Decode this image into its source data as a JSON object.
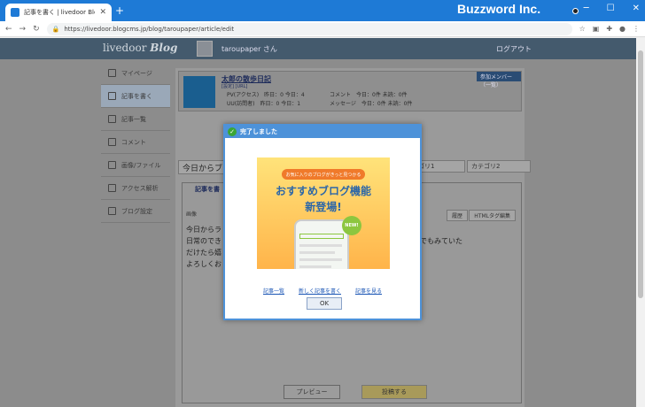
{
  "browser": {
    "tab_title": "記事を書く | livedoor Blog",
    "url": "https://livedoor.blogcms.jp/blog/taroupaper/article/edit",
    "brand_overlay": "Buzzword Inc."
  },
  "header": {
    "logo": "livedoor",
    "logo_blog": "Blog",
    "username": "taroupaper さん",
    "logout": "ログアウト"
  },
  "sidebar": {
    "items": [
      {
        "label": "マイページ"
      },
      {
        "label": "記事を書く"
      },
      {
        "label": "記事一覧"
      },
      {
        "label": "コメント"
      },
      {
        "label": "画像/ファイル"
      },
      {
        "label": "アクセス解析"
      },
      {
        "label": "ブログ設定"
      }
    ]
  },
  "blog": {
    "name": "太郎の散歩日記",
    "links": "[設定] [URL]",
    "join_button": "参加メンバー（一覧）",
    "stats_line1": "PV(アクセス)　昨日：0 今日：4",
    "stats_line2": "UU(訪問者)　昨日：0 今日：1",
    "stats2_line1": "コメント　今日：0件 未読：0件",
    "stats2_line2": "メッセージ　今日：0件 未読：0件"
  },
  "editor": {
    "title_value": "今日からブ",
    "category1": "カテゴリ1",
    "category2": "カテゴリ2",
    "toolbar_label": "記事を書",
    "image_label": "画像",
    "html_button": "HTMLタグ編集",
    "preview_button": "履歴",
    "body_line1": "今日からラ",
    "body_line2": "日常のでき　　　　　　　　　　　　　　　　　　　　　時間のある時にでもみていた",
    "body_line3": "だけたら嬉",
    "body_line4": "よろしくお"
  },
  "bottom": {
    "preview": "プレビュー",
    "post": "投稿する"
  },
  "modal": {
    "title": "完了しました",
    "banner_pill": "お気に入りのブログがきっと見つかる",
    "banner_line1": "おすすめブログ機能",
    "banner_line2": "新登場!",
    "new_badge": "NEW!",
    "link1": "記事一覧",
    "link2": "新しく記事を書く",
    "link3": "記事を見る",
    "ok": "OK"
  }
}
